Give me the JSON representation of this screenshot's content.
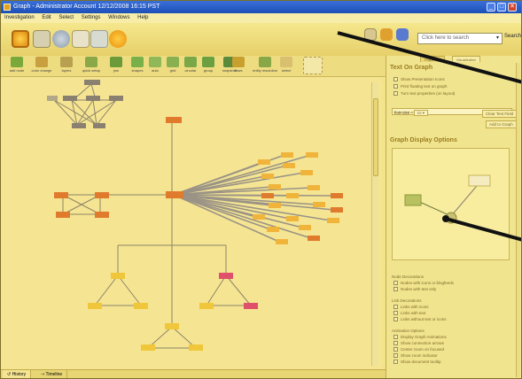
{
  "window": {
    "title": "Graph - Administrator Account 12/12/2008 16:15 PST",
    "controls": [
      "_",
      "□",
      "✕"
    ]
  },
  "menu": [
    "Investigation",
    "Edit",
    "Select",
    "Settings",
    "Windows",
    "Help"
  ],
  "search": {
    "placeholder": "Click here to search",
    "button": "Search"
  },
  "layout_tools": [
    "add node",
    "color change",
    "layers",
    "quick setup",
    "join",
    "shapes",
    "auto",
    "grid",
    "circular",
    "group",
    "snapshot",
    "flows",
    "entity resolution",
    "select"
  ],
  "bottom_tabs": [
    "History",
    "Timeline"
  ],
  "panel": {
    "tabs": [
      "Properties",
      "Visualization"
    ],
    "text_on_graph": {
      "heading": "Text On Graph",
      "options": [
        "Show Presentation Icons",
        "Print floating text on graph",
        "Turn text properties (on layout)"
      ],
      "input_placeholder": "Enter text annotation",
      "text_size_label": "Text Size",
      "text_size_value": "10",
      "clear_button": "Clear Text Field",
      "add_button": "Add to Graph"
    },
    "display": {
      "heading": "Graph Display Options",
      "sections": [
        {
          "title": "Node Decorations",
          "items": [
            "Nodes with icons or blogfeeds",
            "Nodes with text only"
          ]
        },
        {
          "title": "Link Decorations",
          "items": [
            "Links with icons",
            "Links with text",
            "Links without text or icons"
          ]
        },
        {
          "title": "Animation Options",
          "items": [
            "Display Graph Animations",
            "Show connection arrows",
            "Center zoom on focused",
            "Show zoom indicator",
            "Show document tooltip"
          ]
        }
      ]
    }
  },
  "colors": {
    "accent": "#e8a020",
    "node_orange": "#e07a2c",
    "node_yellow": "#f0c63a",
    "node_gray": "#8a8070",
    "node_red": "#e0506a",
    "titlebar": "#2a5fc8"
  }
}
